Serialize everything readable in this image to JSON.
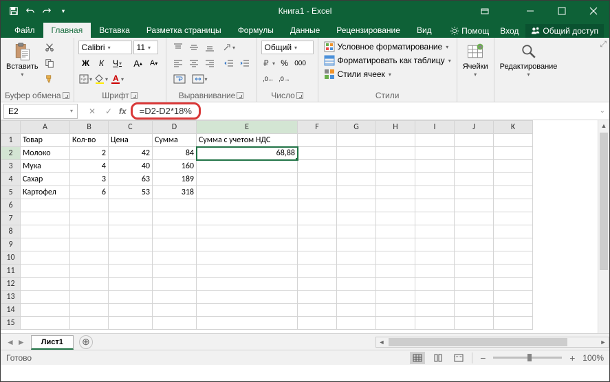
{
  "app": {
    "title": "Книга1 - Excel"
  },
  "tabs": {
    "file": "Файл",
    "home": "Главная",
    "insert": "Вставка",
    "layout": "Разметка страницы",
    "formulas": "Формулы",
    "data": "Данные",
    "review": "Рецензирование",
    "view": "Вид",
    "help": "Помощ",
    "login": "Вход",
    "share": "Общий доступ"
  },
  "ribbon": {
    "clipboard": {
      "label": "Буфер обмена",
      "paste": "Вставить"
    },
    "font": {
      "label": "Шрифт",
      "family": "Calibri",
      "size": "11",
      "bold": "Ж",
      "italic": "К",
      "underline": "Ч"
    },
    "align": {
      "label": "Выравнивание"
    },
    "number": {
      "label": "Число",
      "format": "Общий"
    },
    "styles": {
      "label": "Стили",
      "conditional": "Условное форматирование",
      "table": "Форматировать как таблицу",
      "cell": "Стили ячеек"
    },
    "cells": {
      "label": "Ячейки"
    },
    "editing": {
      "label": "Редактирование"
    }
  },
  "namebox": "E2",
  "formula": "=D2-D2*18%",
  "cols": [
    "A",
    "B",
    "C",
    "D",
    "E",
    "F",
    "G",
    "H",
    "I",
    "J",
    "K"
  ],
  "rows": [
    "1",
    "2",
    "3",
    "4",
    "5",
    "6",
    "7",
    "8",
    "9",
    "10",
    "11",
    "12",
    "13",
    "14",
    "15"
  ],
  "data": {
    "headers": [
      "Товар",
      "Кол-во",
      "Цена",
      "Сумма",
      "Сумма с учетом НДС"
    ],
    "r2": [
      "Молоко",
      "2",
      "42",
      "84",
      "68,88"
    ],
    "r3": [
      "Мука",
      "4",
      "40",
      "160",
      ""
    ],
    "r4": [
      "Сахар",
      "3",
      "63",
      "189",
      ""
    ],
    "r5": [
      "Картофел",
      "6",
      "53",
      "318",
      ""
    ]
  },
  "sheet": "Лист1",
  "status": "Готово",
  "zoom": "100%"
}
